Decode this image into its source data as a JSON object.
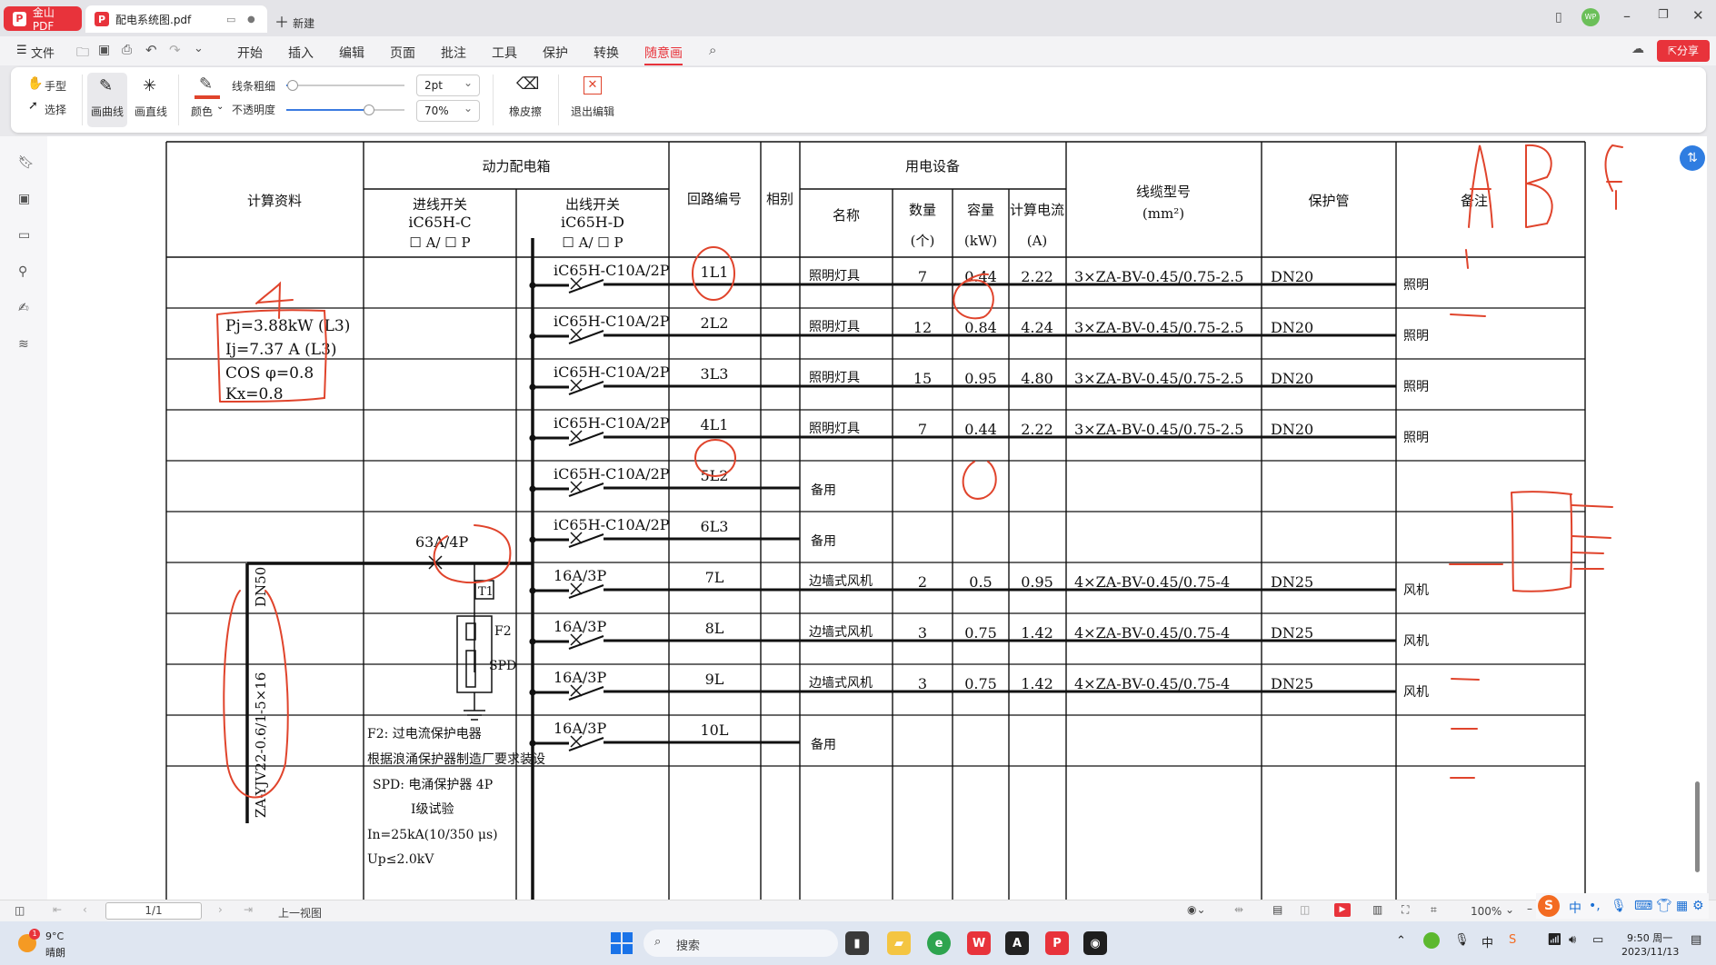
{
  "tabs": [
    {
      "label": "金山PDF"
    },
    {
      "label": "配电系统图.pdf"
    },
    {
      "label": "新建"
    }
  ],
  "menu": {
    "file": "文件",
    "items": [
      "开始",
      "插入",
      "编辑",
      "页面",
      "批注",
      "工具",
      "保护",
      "转换",
      "随意画"
    ],
    "share": "分享"
  },
  "ribbon": {
    "hand": "手型",
    "select": "选择",
    "curve": "画曲线",
    "straight": "画直线",
    "color": "颜色",
    "line_width_label": "线条粗细",
    "opacity_label": "不透明度",
    "line_width_value": "2pt",
    "opacity_value": "70%",
    "eraser": "橡皮擦",
    "exit": "退出编辑",
    "line_width_slider": 0.05,
    "opacity_slider": 0.7
  },
  "status": {
    "page": "1/1",
    "prev_view": "上一视图",
    "zoom": "100%"
  },
  "taskbar": {
    "weather_temp": "9°C",
    "weather_desc": "晴朗",
    "search": "搜索",
    "time": "9:50 周一",
    "date": "2023/11/13",
    "notify": "1"
  },
  "drawing": {
    "col_calc": "计算资料",
    "col_box": "动力配电箱",
    "col_in": "进线开关",
    "col_in_model": "iC65H-C",
    "col_in_opt": "☐ A/ ☐ P",
    "col_out": "出线开关",
    "col_out_model": "iC65H-D",
    "col_out_opt": "☐ A/ ☐ P",
    "col_loop": "回路编号",
    "col_phase": "相别",
    "col_equip": "用电设备",
    "col_name": "名称",
    "col_qty": "数量",
    "col_qty_unit": "(个)",
    "col_cap": "容量",
    "col_cap_unit": "(kW)",
    "col_cur": "计算电流",
    "col_cur_unit": "(A)",
    "col_cable": "线缆型号",
    "col_cable_unit": "(mm²)",
    "col_pipe": "保护管",
    "col_note": "备注",
    "calc_pj": "Pj=3.88kW  (L3)",
    "calc_ij": "Ij=7.37 A  (L3)",
    "calc_cos": "COS φ=0.8",
    "calc_kx": "Kx=0.8",
    "main_switch": "63A/4P",
    "t1": "T1",
    "f2": "F2",
    "spd": "SPD",
    "dn50": "DN50",
    "incoming_cable": "ZA-YJV22-0.6/1-5×16",
    "notes": [
      "F2: 过电流保护电器",
      "根据浪涌保护器制造厂要求装设",
      "SPD: 电涌保护器 4P",
      "I级试验",
      "In=25kA(10/350 μs)",
      "Up≤2.0kV"
    ],
    "rows": [
      {
        "switch": "iC65H-C10A/2P",
        "loop": "1L1",
        "name": "照明灯具",
        "qty": "7",
        "cap": "0.44",
        "cur": "2.22",
        "cable": "3×ZA-BV-0.45/0.75-2.5",
        "pipe": "DN20",
        "note": "照明"
      },
      {
        "switch": "iC65H-C10A/2P",
        "loop": "2L2",
        "name": "照明灯具",
        "qty": "12",
        "cap": "0.84",
        "cur": "4.24",
        "cable": "3×ZA-BV-0.45/0.75-2.5",
        "pipe": "DN20",
        "note": "照明"
      },
      {
        "switch": "iC65H-C10A/2P",
        "loop": "3L3",
        "name": "照明灯具",
        "qty": "15",
        "cap": "0.95",
        "cur": "4.80",
        "cable": "3×ZA-BV-0.45/0.75-2.5",
        "pipe": "DN20",
        "note": "照明"
      },
      {
        "switch": "iC65H-C10A/2P",
        "loop": "4L1",
        "name": "照明灯具",
        "qty": "7",
        "cap": "0.44",
        "cur": "2.22",
        "cable": "3×ZA-BV-0.45/0.75-2.5",
        "pipe": "DN20",
        "note": "照明"
      },
      {
        "switch": "iC65H-C10A/2P",
        "loop": "5L2",
        "name": "备用",
        "qty": "",
        "cap": "",
        "cur": "",
        "cable": "",
        "pipe": "",
        "note": ""
      },
      {
        "switch": "iC65H-C10A/2P",
        "loop": "6L3",
        "name": "备用",
        "qty": "",
        "cap": "",
        "cur": "",
        "cable": "",
        "pipe": "",
        "note": ""
      },
      {
        "switch": "16A/3P",
        "loop": "7L",
        "name": "边墙式风机",
        "qty": "2",
        "cap": "0.5",
        "cur": "0.95",
        "cable": "4×ZA-BV-0.45/0.75-4",
        "pipe": "DN25",
        "note": "风机"
      },
      {
        "switch": "16A/3P",
        "loop": "8L",
        "name": "边墙式风机",
        "qty": "3",
        "cap": "0.75",
        "cur": "1.42",
        "cable": "4×ZA-BV-0.45/0.75-4",
        "pipe": "DN25",
        "note": "风机"
      },
      {
        "switch": "16A/3P",
        "loop": "9L",
        "name": "边墙式风机",
        "qty": "3",
        "cap": "0.75",
        "cur": "1.42",
        "cable": "4×ZA-BV-0.45/0.75-4",
        "pipe": "DN25",
        "note": "风机"
      },
      {
        "switch": "16A/3P",
        "loop": "10L",
        "name": "备用",
        "qty": "",
        "cap": "",
        "cur": "",
        "cable": "",
        "pipe": "",
        "note": ""
      }
    ],
    "annotation_color": "#e0442c"
  }
}
